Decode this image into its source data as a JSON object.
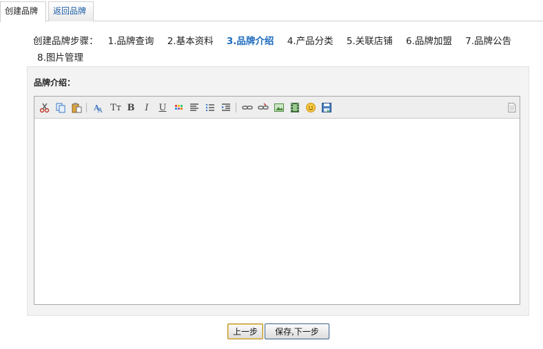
{
  "tabs": [
    {
      "label": "创建品牌",
      "active": true
    },
    {
      "label": "返回品牌",
      "active": false
    }
  ],
  "steps": {
    "label": "创建品牌步骤：",
    "items": [
      "1.品牌查询",
      "2.基本资料",
      "3.品牌介绍",
      "4.产品分类",
      "5.关联店铺",
      "6.品牌加盟",
      "7.品牌公告",
      "8.图片管理"
    ],
    "current_index": 2
  },
  "form": {
    "intro_label": "品牌介绍：",
    "editor_content": ""
  },
  "toolbar": {
    "tools": [
      "cut-icon",
      "copy-icon",
      "paste-icon",
      "font-color-icon",
      "font-size-icon",
      "bold-icon",
      "italic-icon",
      "underline-icon",
      "background-color-icon",
      "align-icon",
      "list-icon",
      "indent-icon",
      "link-icon",
      "unlink-icon",
      "image-icon",
      "media-icon",
      "emoticon-icon",
      "save-icon",
      "source-icon"
    ],
    "font_size_glyph": "Tт",
    "bold_glyph": "B",
    "italic_glyph": "I",
    "underline_glyph": "U"
  },
  "buttons": {
    "prev": "上一步",
    "save_next": "保存,下一步"
  },
  "colors": {
    "current_step": "#1d6bbd",
    "tab_link": "#1c5fa8",
    "panel_bg": "#f3f3f3"
  }
}
